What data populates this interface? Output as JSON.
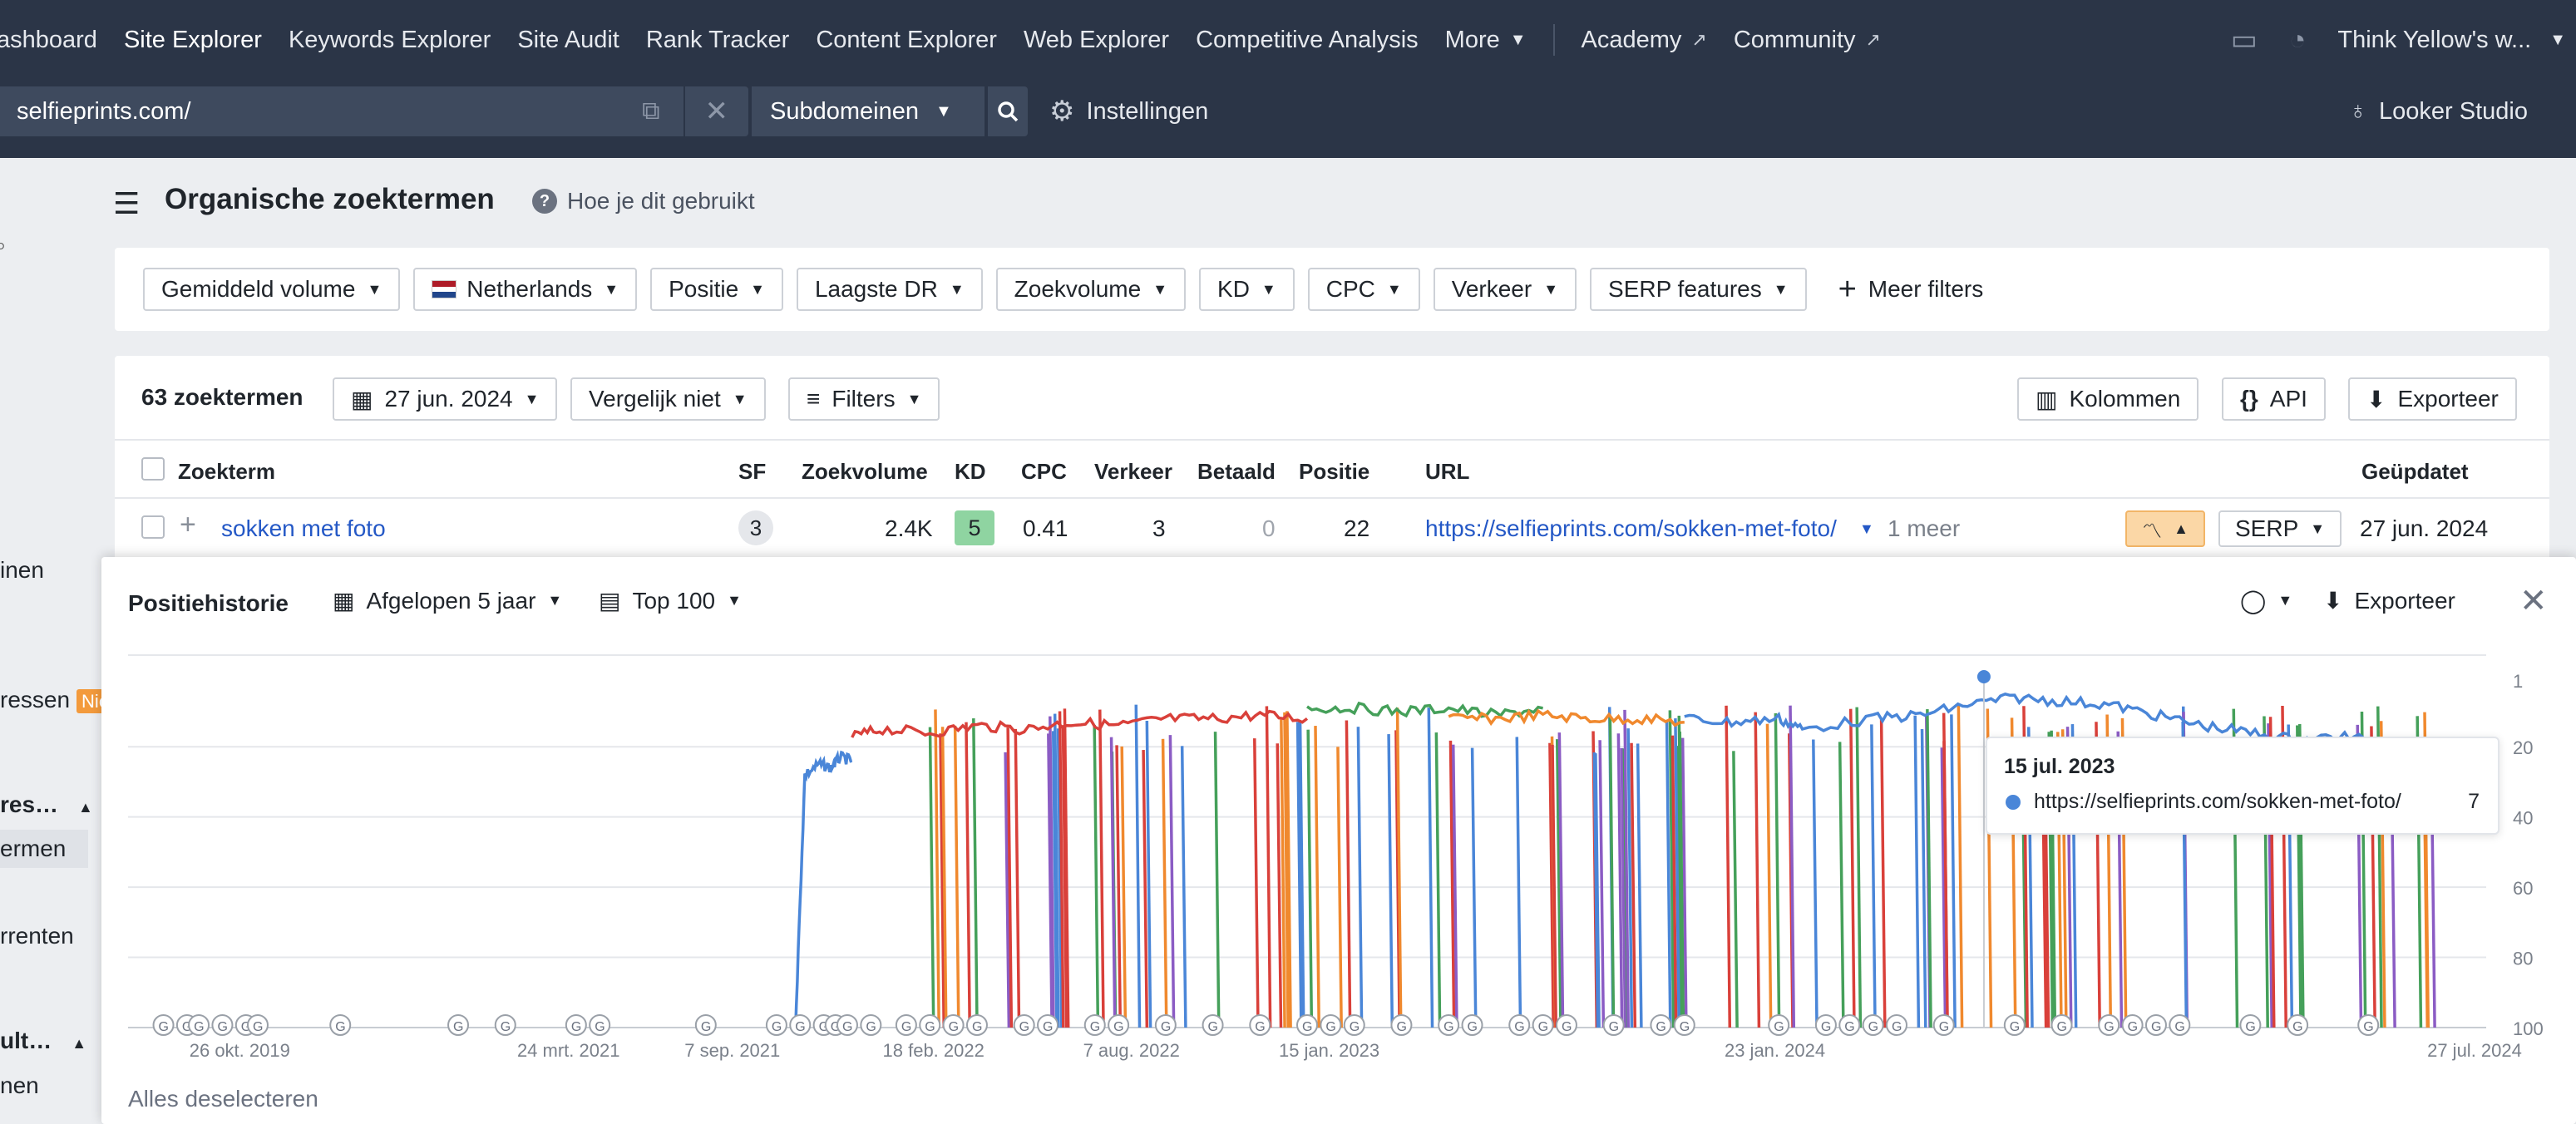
{
  "topnav": {
    "items": [
      {
        "label": "ashboard",
        "active": false
      },
      {
        "label": "Site Explorer",
        "active": true
      },
      {
        "label": "Keywords Explorer",
        "active": false
      },
      {
        "label": "Site Audit",
        "active": false
      },
      {
        "label": "Rank Tracker",
        "active": false
      },
      {
        "label": "Content Explorer",
        "active": false
      },
      {
        "label": "Web Explorer",
        "active": false
      },
      {
        "label": "Competitive Analysis",
        "active": false
      }
    ],
    "more_label": "More",
    "academy_label": "Academy",
    "community_label": "Community",
    "account_label": "Think Yellow's w..."
  },
  "search": {
    "url_value": "selfieprints.com/",
    "mode_label": "Subdomeinen",
    "settings_label": "Instellingen",
    "looker_label": "Looker Studio"
  },
  "sidebar": {
    "items": [
      {
        "label": "inen"
      },
      {
        "label": "ressen"
      },
      {
        "label": "res…"
      },
      {
        "label": "ermen"
      },
      {
        "label": "rrenten"
      },
      {
        "label": "ult…"
      },
      {
        "label": "nen"
      }
    ],
    "badge_new": "Nie"
  },
  "page": {
    "title": "Organische zoektermen",
    "howto_label": "Hoe je dit gebruikt"
  },
  "filters": {
    "buttons": [
      "Gemiddeld volume",
      "Netherlands",
      "Positie",
      "Laagste DR",
      "Zoekvolume",
      "KD",
      "CPC",
      "Verkeer",
      "SERP features"
    ],
    "more_label": "Meer filters"
  },
  "results": {
    "count_label": "63 zoektermen",
    "date_label": "27 jun. 2024",
    "compare_label": "Vergelijk niet",
    "filters_label": "Filters",
    "columns_label": "Kolommen",
    "api_label": "API",
    "export_label": "Exporteer"
  },
  "table": {
    "headers": {
      "keyword": "Zoekterm",
      "sf": "SF",
      "volume": "Zoekvolume",
      "kd": "KD",
      "cpc": "CPC",
      "traffic": "Verkeer",
      "paid": "Betaald",
      "position": "Positie",
      "url": "URL",
      "updated": "Geüpdatet"
    },
    "row": {
      "keyword": "sokken met foto",
      "sf": "3",
      "volume": "2.4K",
      "kd": "5",
      "cpc": "0.41",
      "traffic": "3",
      "paid": "0",
      "position": "22",
      "url": "https://selfieprints.com/sokken-met-foto/",
      "more": "1 meer",
      "serp_label": "SERP",
      "updated": "27 jun. 2024"
    }
  },
  "history": {
    "title": "Positiehistorie",
    "range_label": "Afgelopen 5 jaar",
    "top_label": "Top 100",
    "export_label": "Exporteer",
    "deselect_label": "Alles deselecteren"
  },
  "chart_data": {
    "type": "line",
    "title": "",
    "xlabel": "",
    "ylabel": "",
    "y_reversed": true,
    "ylim": [
      1,
      100
    ],
    "yticks": [
      1,
      20,
      40,
      60,
      80,
      100
    ],
    "xticks": [
      "26 okt. 2019",
      "24 mrt. 2021",
      "7 sep. 2021",
      "18 feb. 2022",
      "7 aug. 2022",
      "15 jan. 2023",
      "23 jan. 2024",
      "27 jul. 2024"
    ],
    "grid": true,
    "series_colors": [
      "#4a86d8",
      "#d9403a",
      "#45a05a",
      "#f0892e",
      "#8b5cc4",
      "#f2d06b",
      "#f5c99a"
    ],
    "series_sample": [
      {
        "color": "#4a86d8",
        "points": [
          [
            0.283,
            100
          ],
          [
            0.287,
            28
          ],
          [
            0.293,
            25
          ],
          [
            0.298,
            26
          ],
          [
            0.302,
            23
          ],
          [
            0.307,
            24
          ]
        ]
      },
      {
        "color": "#d9403a",
        "points": [
          [
            0.307,
            17
          ],
          [
            0.32,
            15
          ],
          [
            0.34,
            16
          ],
          [
            0.36,
            14
          ],
          [
            0.38,
            15
          ],
          [
            0.4,
            13
          ],
          [
            0.42,
            14
          ],
          [
            0.44,
            12
          ],
          [
            0.46,
            12
          ],
          [
            0.48,
            11
          ],
          [
            0.5,
            12
          ]
        ]
      },
      {
        "color": "#45a05a",
        "points": [
          [
            0.5,
            9
          ],
          [
            0.52,
            9
          ],
          [
            0.54,
            10
          ],
          [
            0.56,
            9
          ],
          [
            0.58,
            11
          ],
          [
            0.6,
            9
          ]
        ]
      },
      {
        "color": "#f0892e",
        "points": [
          [
            0.56,
            12
          ],
          [
            0.58,
            12
          ],
          [
            0.6,
            11
          ],
          [
            0.62,
            12
          ],
          [
            0.64,
            12
          ],
          [
            0.66,
            13
          ]
        ]
      },
      {
        "color": "#4a86d8",
        "points": [
          [
            0.66,
            12
          ],
          [
            0.68,
            13
          ],
          [
            0.7,
            12
          ],
          [
            0.71,
            15
          ],
          [
            0.74,
            12
          ],
          [
            0.76,
            11
          ],
          [
            0.78,
            8
          ],
          [
            0.8,
            6
          ],
          [
            0.82,
            7
          ],
          [
            0.84,
            8
          ],
          [
            0.86,
            11
          ],
          [
            0.88,
            14
          ],
          [
            0.9,
            16
          ],
          [
            0.92,
            18
          ],
          [
            0.94,
            17
          ],
          [
            0.96,
            20
          ],
          [
            0.98,
            19
          ]
        ]
      }
    ],
    "tooltip": {
      "date": "15 jul. 2023",
      "url": "https://selfieprints.com/sokken-met-foto/",
      "value": "7"
    }
  }
}
